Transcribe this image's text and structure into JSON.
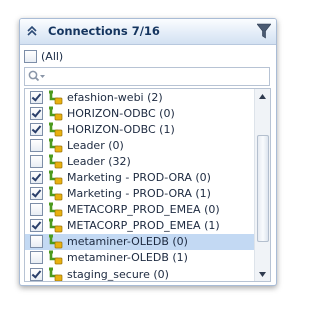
{
  "panel": {
    "title": "Connections 7/16",
    "collapse_icon": "double-chevron-up-icon",
    "filter_icon": "funnel-icon"
  },
  "select_all": {
    "label": "(All)",
    "checked": false
  },
  "search": {
    "value": "",
    "placeholder": "",
    "icon": "magnifier-dropdown-icon"
  },
  "list": {
    "items": [
      {
        "label": "efashion-webi (2)",
        "checked": true,
        "selected": false
      },
      {
        "label": "HORIZON-ODBC (0)",
        "checked": true,
        "selected": false
      },
      {
        "label": "HORIZON-ODBC (1)",
        "checked": true,
        "selected": false
      },
      {
        "label": "Leader (0)",
        "checked": false,
        "selected": false
      },
      {
        "label": "Leader (32)",
        "checked": false,
        "selected": false
      },
      {
        "label": "Marketing - PROD-ORA (0)",
        "checked": true,
        "selected": false
      },
      {
        "label": "Marketing - PROD-ORA (1)",
        "checked": true,
        "selected": false
      },
      {
        "label": "METACORP_PROD_EMEA (0)",
        "checked": false,
        "selected": false
      },
      {
        "label": "METACORP_PROD_EMEA (1)",
        "checked": true,
        "selected": false
      },
      {
        "label": "metaminer-OLEDB (0)",
        "checked": false,
        "selected": true
      },
      {
        "label": "metaminer-OLEDB (1)",
        "checked": false,
        "selected": false
      },
      {
        "label": "staging_secure (0)",
        "checked": true,
        "selected": false
      }
    ],
    "item_icon": "connection-icon"
  },
  "scrollbar": {
    "position_fraction": 0.55
  },
  "colors": {
    "header_text": "#15355f",
    "selection": "#c3d9f3",
    "border": "#a9bcd6",
    "connection_icon_green": "#4c9a1e",
    "connection_icon_yellow": "#e8b010"
  }
}
